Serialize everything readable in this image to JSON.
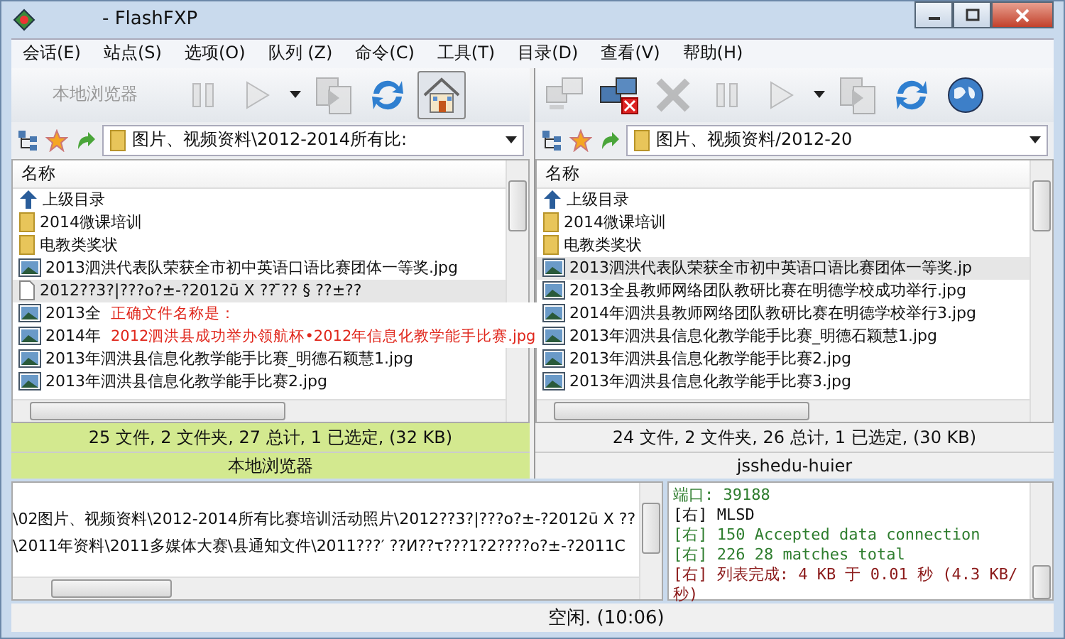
{
  "window": {
    "title": "- FlashFXP"
  },
  "menu": [
    "会话(E)",
    "站点(S)",
    "选项(O)",
    "队列 (Z)",
    "命令(C)",
    "工具(T)",
    "目录(D)",
    "查看(V)",
    "帮助(H)"
  ],
  "panels": [
    {
      "toolbar": {
        "label": "本地浏览器",
        "buttons": [
          {
            "kind": "pause",
            "disabled": true,
            "selected": false
          },
          {
            "kind": "play",
            "disabled": true,
            "selected": false
          },
          {
            "kind": "caret",
            "disabled": false,
            "selected": false
          },
          {
            "kind": "transfer",
            "disabled": true,
            "selected": false
          },
          {
            "kind": "refresh",
            "disabled": false,
            "selected": false
          },
          {
            "kind": "home",
            "disabled": false,
            "selected": true
          }
        ]
      },
      "path": "图片、视频资料\\2012-2014所有比:",
      "column": "名称",
      "rows": [
        {
          "kind": "up",
          "name": "上级目录",
          "selected": false
        },
        {
          "kind": "folder",
          "name": "2014微课培训",
          "selected": false
        },
        {
          "kind": "folder",
          "name": "电教类奖状",
          "selected": false
        },
        {
          "kind": "image",
          "name": "2013泗洪代表队荣获全市初中英语口语比赛团体一等奖.jpg",
          "selected": false
        },
        {
          "kind": "file",
          "name": "2012??3?|???o?±-?2012ū X ?? ̄?? § ??±??",
          "selected": true
        },
        {
          "kind": "image",
          "name": "2013全",
          "selected": false
        },
        {
          "kind": "image",
          "name": "2014年",
          "selected": false
        },
        {
          "kind": "image",
          "name": "2013年泗洪县信息化教学能手比赛_明德石颖慧1.jpg",
          "selected": false
        },
        {
          "kind": "image",
          "name": "2013年泗洪县信息化教学能手比赛2.jpg",
          "selected": false
        }
      ],
      "summary": "25 文件, 2 文件夹, 27 总计, 1 已选定, (32 KB)",
      "site": "本地浏览器",
      "active": true
    },
    {
      "toolbar": {
        "buttons": [
          {
            "kind": "connect",
            "disabled": true,
            "selected": false
          },
          {
            "kind": "disconnect",
            "disabled": false,
            "selected": false
          },
          {
            "kind": "abort",
            "disabled": true,
            "selected": false
          },
          {
            "kind": "pause",
            "disabled": true,
            "selected": false
          },
          {
            "kind": "play",
            "disabled": true,
            "selected": false
          },
          {
            "kind": "caret",
            "disabled": false,
            "selected": false
          },
          {
            "kind": "transfer",
            "disabled": true,
            "selected": false
          },
          {
            "kind": "refresh",
            "disabled": false,
            "selected": false
          },
          {
            "kind": "globe",
            "disabled": false,
            "selected": false
          }
        ]
      },
      "path": "图片、视频资料/2012-20",
      "column": "名称",
      "rows": [
        {
          "kind": "up",
          "name": "上级目录",
          "selected": false
        },
        {
          "kind": "folder",
          "name": "2014微课培训",
          "selected": false
        },
        {
          "kind": "folder",
          "name": "电教类奖状",
          "selected": false
        },
        {
          "kind": "image",
          "name": "2013泗洪代表队荣获全市初中英语口语比赛团体一等奖.jp",
          "selected": true
        },
        {
          "kind": "image",
          "name": "2013全县教师网络团队教研比赛在明德学校成功举行.jpg",
          "selected": false
        },
        {
          "kind": "image",
          "name": "2014年泗洪县教师网络团队教研比赛在明德学校举行3.jpg",
          "selected": false
        },
        {
          "kind": "image",
          "name": "2013年泗洪县信息化教学能手比赛_明德石颖慧1.jpg",
          "selected": false
        },
        {
          "kind": "image",
          "name": "2013年泗洪县信息化教学能手比赛2.jpg",
          "selected": false
        },
        {
          "kind": "image",
          "name": "2013年泗洪县信息化教学能手比赛3.jpg",
          "selected": false
        }
      ],
      "summary": "24 文件, 2 文件夹, 26 总计, 1 已选定, (30 KB)",
      "site": "jsshedu-huier",
      "active": false
    }
  ],
  "annotation": [
    "正确文件名称是：",
    "2012泗洪县成功举办领航杯•2012年信息化教学能手比赛.jpg"
  ],
  "queue": [
    "\\02图片、视频资料\\2012-2014所有比赛培训活动照片\\2012??3?|???o?±-?2012ū X ??",
    "\\2011年资料\\2011多媒体大赛\\县通知文件\\2011???′ ??И??τ???1?2????o?±-?2011C"
  ],
  "log": [
    {
      "kind": "status",
      "text": "端口: 39188"
    },
    {
      "kind": "command",
      "text": "[右] MLSD"
    },
    {
      "kind": "status",
      "text": "[右] 150 Accepted data connection"
    },
    {
      "kind": "status",
      "text": "[右] 226 28 matches total"
    },
    {
      "kind": "done",
      "text": "[右] 列表完成: 4 KB 于 0.01 秒 (4.3 KB/秒)"
    }
  ],
  "status_bar": "空闲. (10:06)"
}
